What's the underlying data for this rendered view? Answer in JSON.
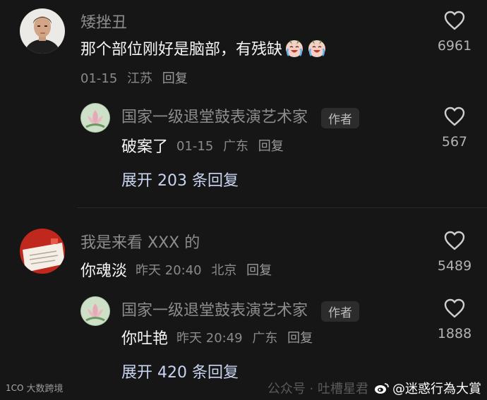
{
  "comments": [
    {
      "name": "矮挫丑",
      "text": "那个部位刚好是脑部，有残缺",
      "emoji": "crying-laughing-face-icon",
      "date": "01-15",
      "location": "江苏",
      "reply_label": "回复",
      "likes": "6961",
      "reply": {
        "name": "国家一级退堂鼓表演艺术家",
        "badge": "作者",
        "text": "破案了",
        "date": "01-15",
        "location": "广东",
        "reply_label": "回复",
        "likes": "567"
      },
      "expand_label": "展开 203 条回复"
    },
    {
      "name": "我是来看 XXX 的",
      "text": "你魂淡",
      "date": "昨天 20:40",
      "location": "北京",
      "reply_label": "回复",
      "likes": "5489",
      "reply": {
        "name": "国家一级退堂鼓表演艺术家",
        "badge": "作者",
        "text": "你吐艳",
        "date": "昨天 20:49",
        "location": "广东",
        "reply_label": "回复",
        "likes": "1888"
      },
      "expand_label": "展开 420 条回复"
    }
  ],
  "watermarks": {
    "left_logo": "1CO",
    "left_text": "大数跨境",
    "right_faint": "公众号 · 吐槽星君",
    "right_strong": "@迷惑行為大賞"
  },
  "colors": {
    "background": "#161616",
    "expand_link": "#c8d4f0",
    "meta": "#8a8a8a"
  }
}
